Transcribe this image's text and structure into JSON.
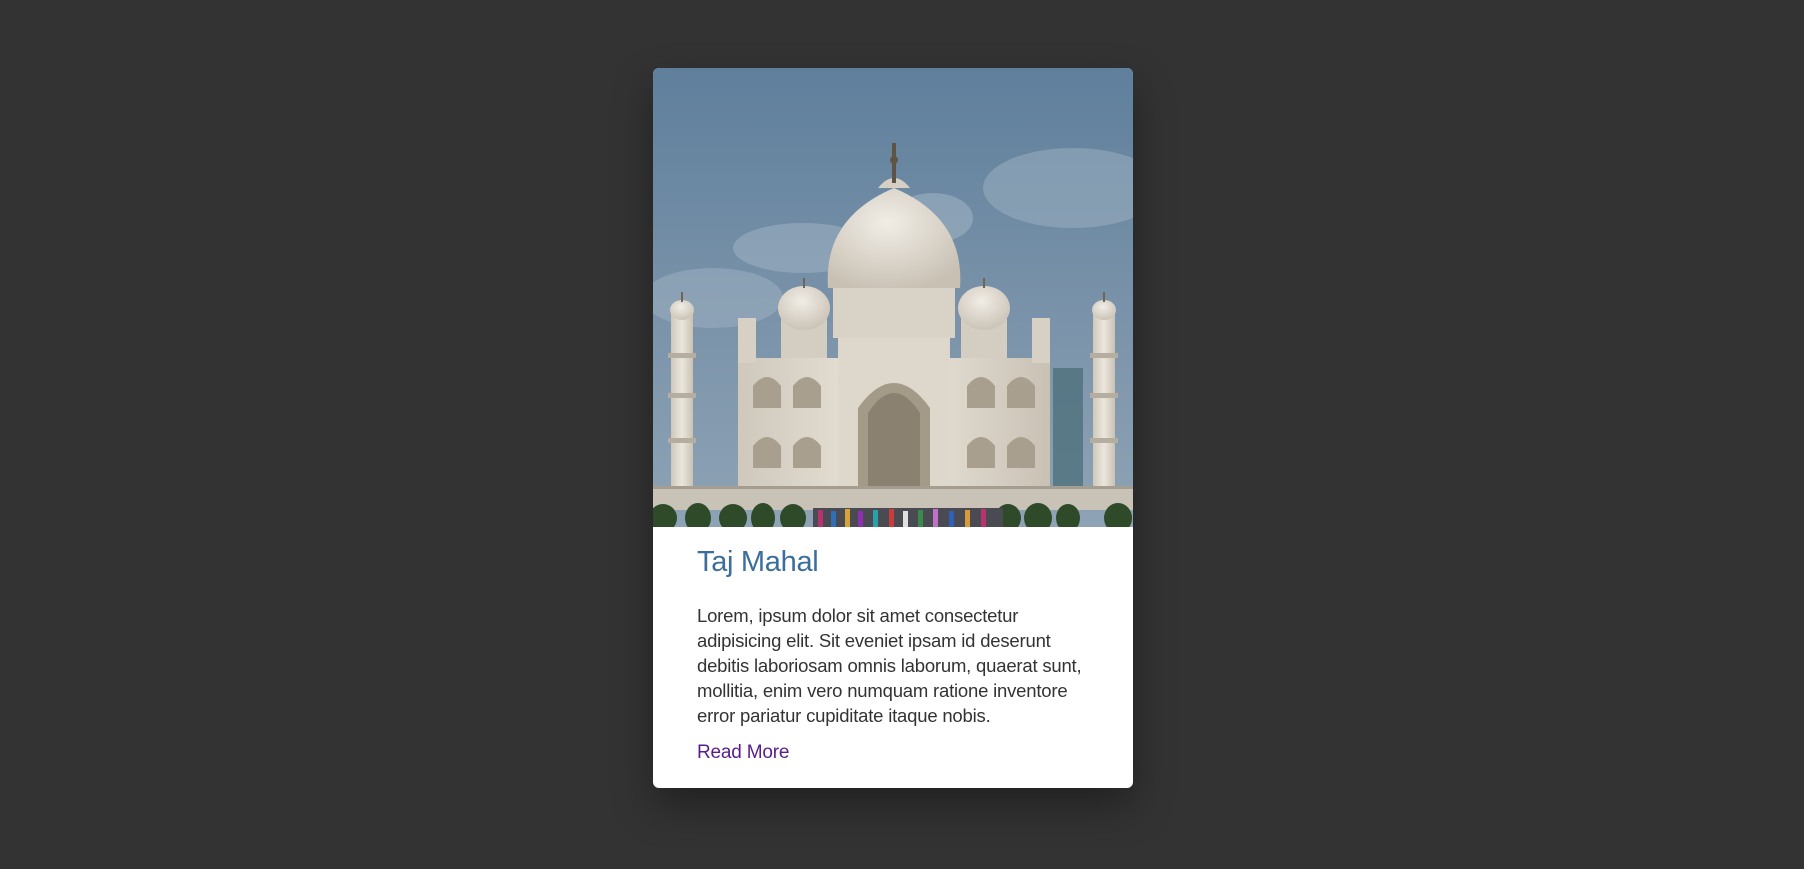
{
  "card": {
    "image_alt": "Taj Mahal",
    "title": "Taj Mahal",
    "description": "Lorem, ipsum dolor sit amet consectetur adipisicing elit. Sit eveniet ipsam id deserunt debitis laboriosam omnis laborum, quaerat sunt, mollitia, enim vero numquam ratione inventore error pariatur cupiditate itaque nobis.",
    "link_label": "Read More"
  },
  "colors": {
    "page_background": "#333333",
    "card_background": "#ffffff",
    "title": "#3b6e9b",
    "body_text": "#333333",
    "link": "#5b1d8a"
  }
}
